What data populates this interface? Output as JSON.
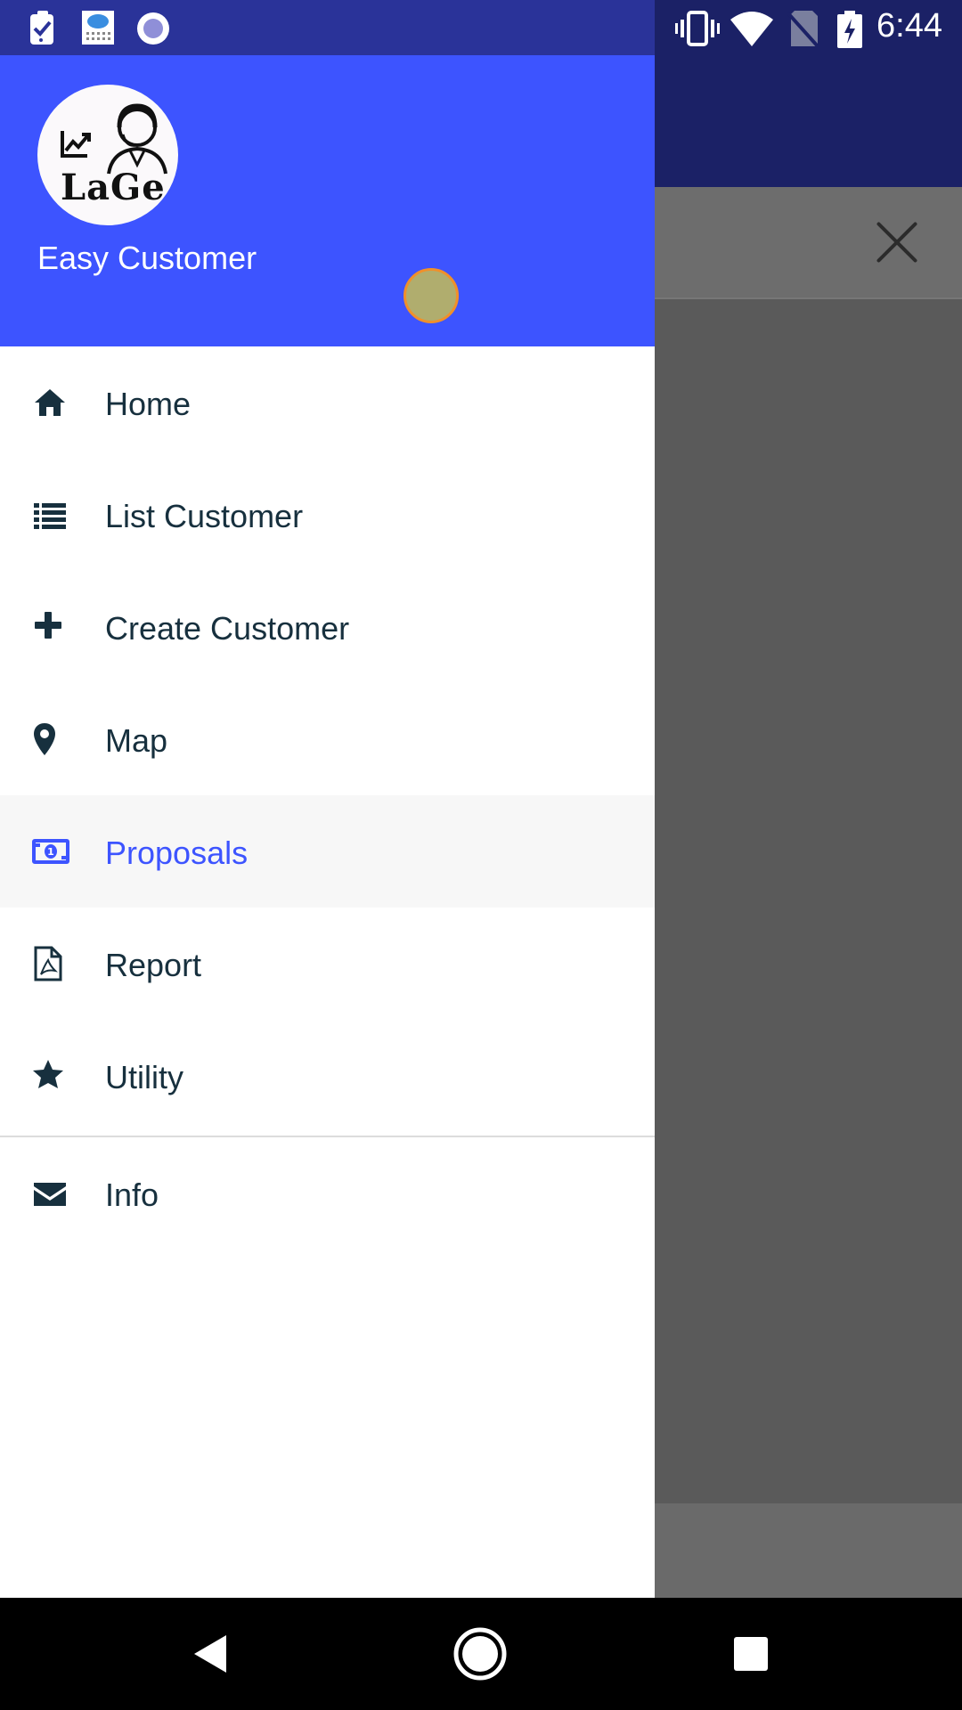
{
  "status_bar": {
    "time": "6:44",
    "icons_left": [
      "task-notification-icon",
      "cloud-weather-icon",
      "circle-app-icon"
    ],
    "icons_right": [
      "vibrate-icon",
      "wifi-icon",
      "no-sim-icon",
      "battery-charging-icon"
    ]
  },
  "drawer": {
    "logo_text": "LaGe",
    "app_name": "Easy Customer",
    "accent_color": "#3d54ff",
    "items": [
      {
        "label": "Home",
        "icon": "home-icon",
        "active": false
      },
      {
        "label": "List Customer",
        "icon": "list-icon",
        "active": false
      },
      {
        "label": "Create Customer",
        "icon": "plus-icon",
        "active": false
      },
      {
        "label": "Map",
        "icon": "map-pin-icon",
        "active": false
      },
      {
        "label": "Proposals",
        "icon": "money-bill-icon",
        "active": true
      },
      {
        "label": "Report",
        "icon": "pdf-file-icon",
        "active": false
      },
      {
        "label": "Utility",
        "icon": "star-icon",
        "active": false
      }
    ],
    "secondary_items": [
      {
        "label": "Info",
        "icon": "envelope-icon",
        "active": false
      }
    ]
  },
  "background_app": {
    "close_icon": "close-icon"
  },
  "nav_bar": {
    "buttons": [
      "back-icon",
      "home-circle-icon",
      "recents-icon"
    ]
  }
}
